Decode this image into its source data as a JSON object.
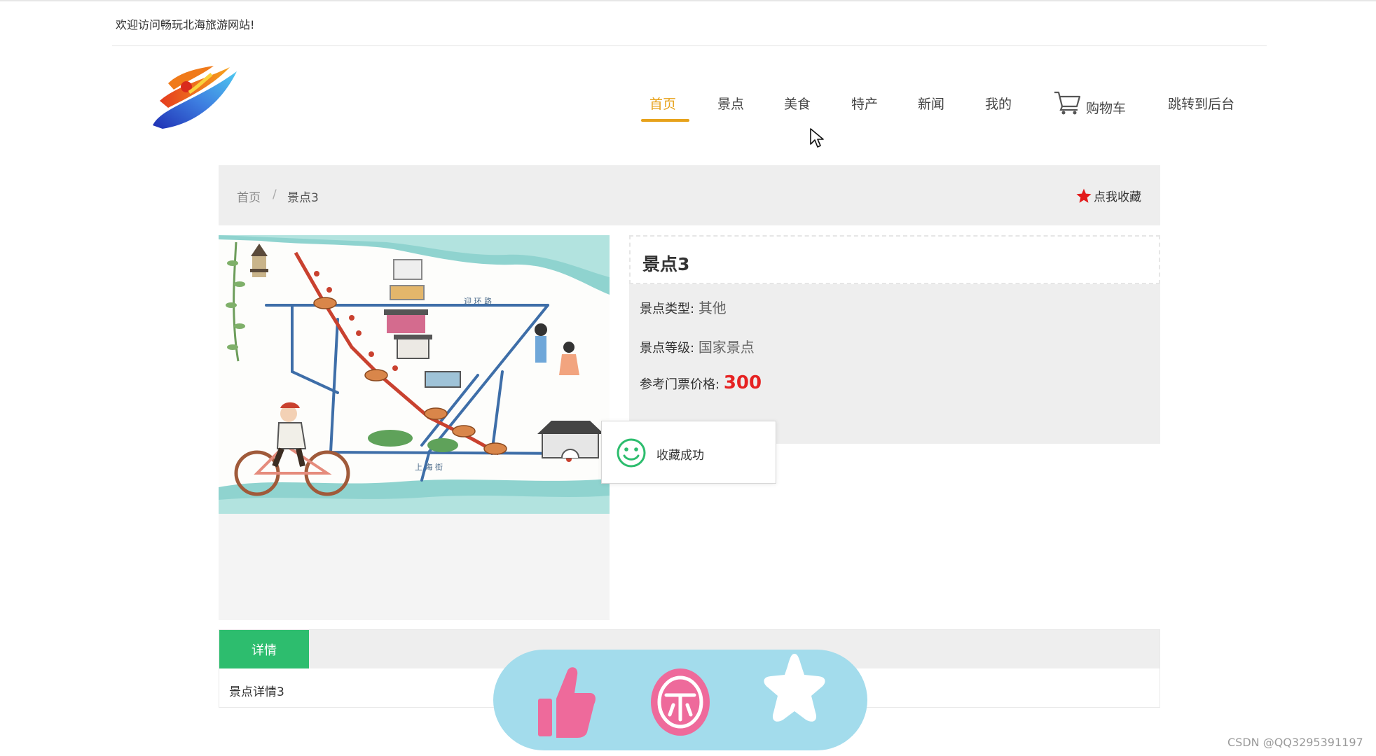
{
  "header": {
    "welcome": "欢迎访问畅玩北海旅游网站!"
  },
  "nav": {
    "home": "首页",
    "scenic": "景点",
    "food": "美食",
    "specialty": "特产",
    "news": "新闻",
    "mine": "我的",
    "cart": "购物车",
    "admin": "跳转到后台",
    "active": "首页",
    "accent_color": "#e7a21b"
  },
  "breadcrumb": {
    "home": "首页",
    "separator": "/",
    "current": "景点3"
  },
  "favorite": {
    "label": "点我收藏",
    "icon": "red-star-icon"
  },
  "spot": {
    "title": "景点3",
    "type_label": "景点类型:",
    "type_value": "其他",
    "level_label": "景点等级:",
    "level_value": "国家景点",
    "price_label": "参考门票价格:",
    "price_value": "300",
    "price_color": "#e62222"
  },
  "toast": {
    "message": "收藏成功",
    "icon": "smile-icon"
  },
  "detail": {
    "tab_label": "详情",
    "tab_color": "#2dbd6e",
    "content": "景点详情3"
  },
  "action_bar": {
    "icons": [
      "thumbs-up-icon",
      "coin-icon",
      "star-icon"
    ],
    "bg_color": "#a3dcec",
    "accent_color": "#ee6a9b"
  },
  "watermark": "CSDN @QQ3295391197"
}
